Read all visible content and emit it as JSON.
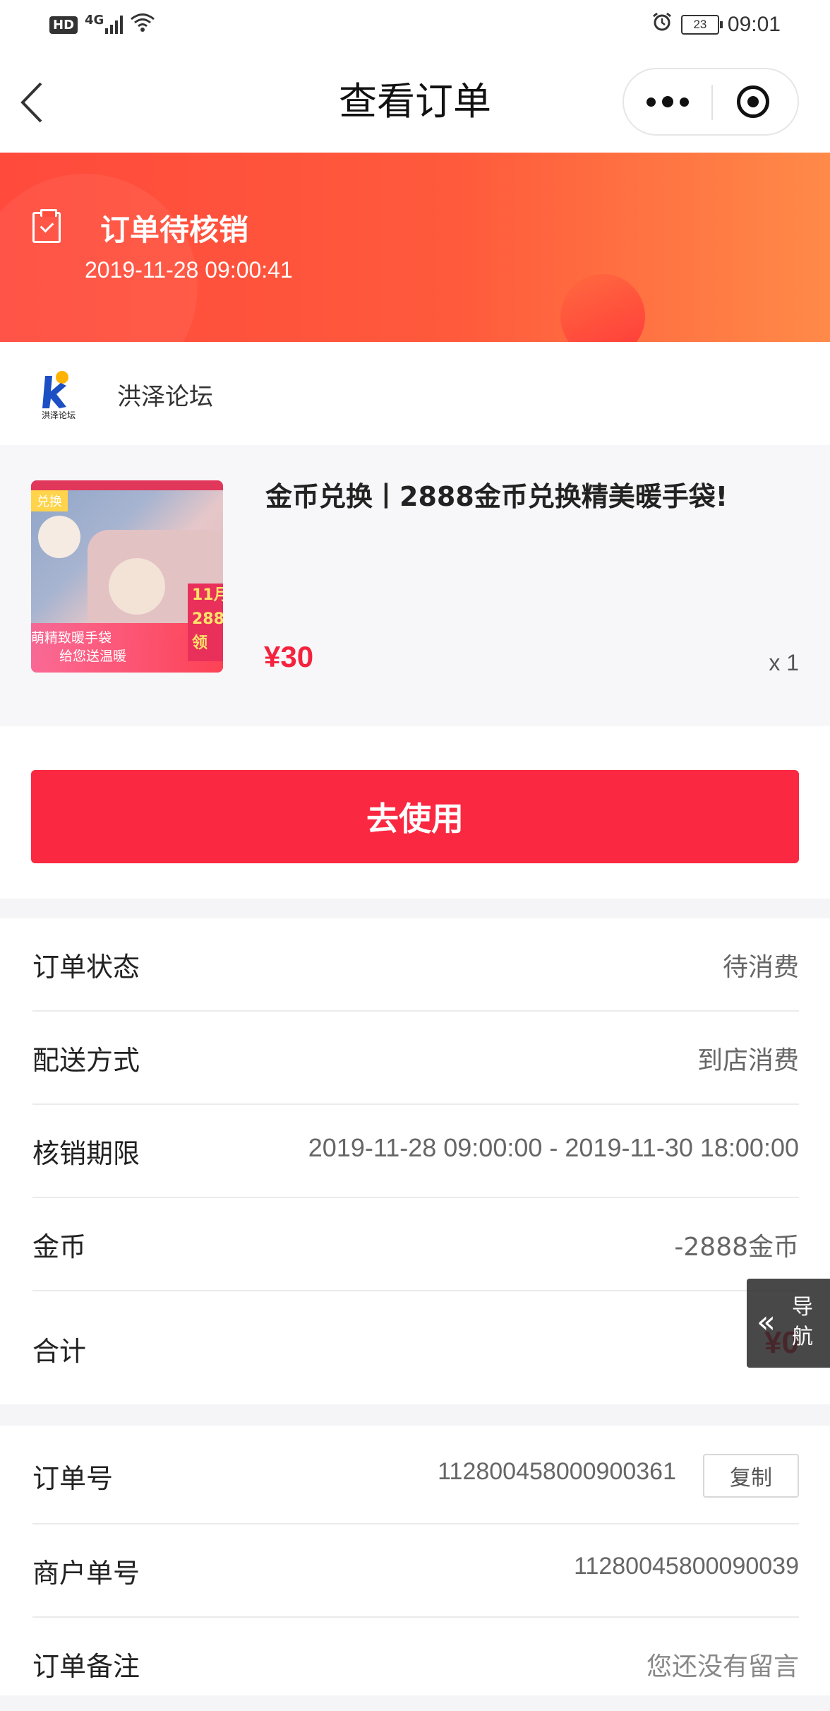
{
  "status_bar": {
    "hd": "HD",
    "network": "4G",
    "battery": "23",
    "time": "09:01"
  },
  "nav": {
    "title": "查看订单"
  },
  "banner": {
    "status": "订单待核销",
    "datetime": "2019-11-28  09:00:41",
    "gradient_start": "#ff4a3c",
    "gradient_end": "#ff8a48"
  },
  "shop": {
    "logo_text": "洪泽论坛",
    "name": "洪泽论坛"
  },
  "product": {
    "thumbnail": {
      "tag": "兑换",
      "line1": "萌精致暖手袋",
      "line2": "给您送温暖",
      "side_text": "11月 288 领"
    },
    "title": "金币兑换丨2888金币兑换精美暖手袋!",
    "price": "¥30",
    "quantity": "x 1"
  },
  "use_button": {
    "label": "去使用",
    "color": "#fa2840"
  },
  "order_info": [
    {
      "label": "订单状态",
      "value": "待消费"
    },
    {
      "label": "配送方式",
      "value": "到店消费"
    },
    {
      "label": "核销期限",
      "value": "2019-11-28  09:00:00  -  2019-11-30  18:00:00"
    },
    {
      "label": "金币",
      "value": "-2888金币"
    },
    {
      "label": "合计",
      "value": "¥0"
    }
  ],
  "order_meta": [
    {
      "label": "订单号",
      "value": "112800458000900361",
      "action": "复制"
    },
    {
      "label": "商户单号",
      "value": "11280045800090039"
    },
    {
      "label": "订单备注",
      "value": "您还没有留言"
    }
  ],
  "float_nav": {
    "label_1": "导",
    "label_2": "航"
  },
  "accent_color": "#f5223e"
}
